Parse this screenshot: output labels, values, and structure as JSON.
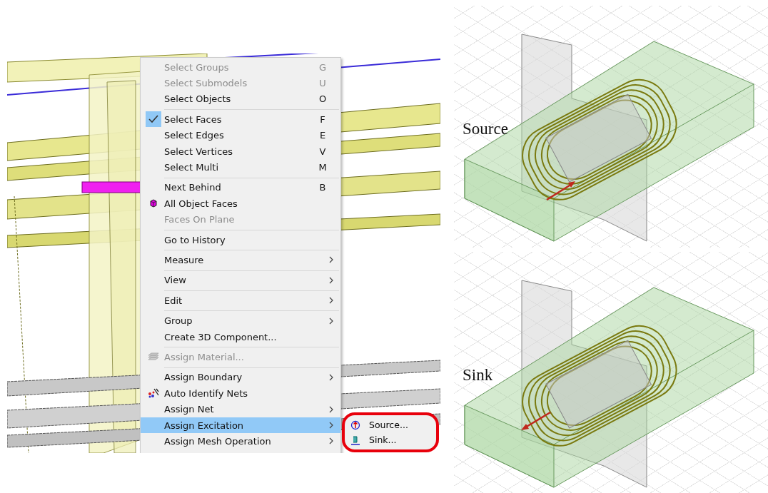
{
  "context_menu": {
    "groups": [
      [
        {
          "label": "Select Groups",
          "shortcut": "G",
          "disabled": true,
          "checked": false,
          "selected": false,
          "kind": "text"
        },
        {
          "label": "Select Submodels",
          "shortcut": "U",
          "disabled": true,
          "checked": false,
          "selected": false,
          "kind": "text"
        },
        {
          "label": "Select Objects",
          "shortcut": "O",
          "disabled": false,
          "checked": false,
          "selected": false,
          "kind": "text"
        }
      ],
      [
        {
          "label": "Select Faces",
          "shortcut": "F",
          "disabled": false,
          "checked": true,
          "selected": false,
          "kind": "text"
        },
        {
          "label": "Select Edges",
          "shortcut": "E",
          "disabled": false,
          "checked": false,
          "selected": false,
          "kind": "text"
        },
        {
          "label": "Select Vertices",
          "shortcut": "V",
          "disabled": false,
          "checked": false,
          "selected": false,
          "kind": "text"
        },
        {
          "label": "Select Multi",
          "shortcut": "M",
          "disabled": false,
          "checked": false,
          "selected": false,
          "kind": "text"
        }
      ],
      [
        {
          "label": "Next Behind",
          "shortcut": "B",
          "disabled": false,
          "checked": false,
          "selected": false,
          "kind": "text"
        },
        {
          "label": "All Object Faces",
          "disabled": false,
          "checked": false,
          "selected": false,
          "kind": "faces"
        },
        {
          "label": "Faces On Plane",
          "disabled": true,
          "checked": false,
          "selected": false,
          "kind": "text"
        }
      ],
      [
        {
          "label": "Go to History",
          "disabled": false,
          "checked": false,
          "selected": false,
          "kind": "text"
        }
      ],
      [
        {
          "label": "Measure",
          "submenu": true,
          "disabled": false,
          "checked": false,
          "selected": false,
          "kind": "text"
        }
      ],
      [
        {
          "label": "View",
          "submenu": true,
          "disabled": false,
          "checked": false,
          "selected": false,
          "kind": "text"
        }
      ],
      [
        {
          "label": "Edit",
          "submenu": true,
          "disabled": false,
          "checked": false,
          "selected": false,
          "kind": "text"
        }
      ],
      [
        {
          "label": "Group",
          "submenu": true,
          "disabled": false,
          "checked": false,
          "selected": false,
          "kind": "text"
        },
        {
          "label": "Create 3D Component...",
          "disabled": false,
          "checked": false,
          "selected": false,
          "kind": "text"
        }
      ],
      [
        {
          "label": "Assign Material...",
          "disabled": true,
          "checked": false,
          "selected": false,
          "kind": "material"
        }
      ],
      [
        {
          "label": "Assign Boundary",
          "submenu": true,
          "disabled": false,
          "checked": false,
          "selected": false,
          "kind": "text"
        },
        {
          "label": "Auto Identify Nets",
          "disabled": false,
          "checked": false,
          "selected": false,
          "kind": "nets"
        },
        {
          "label": "Assign Net",
          "submenu": true,
          "disabled": false,
          "checked": false,
          "selected": false,
          "kind": "text"
        },
        {
          "label": "Assign Excitation",
          "submenu": true,
          "disabled": false,
          "checked": false,
          "selected": true,
          "kind": "text"
        },
        {
          "label": "Assign Mesh Operation",
          "submenu": true,
          "disabled": false,
          "checked": false,
          "selected": false,
          "kind": "text"
        }
      ]
    ]
  },
  "submenu": {
    "highlighted": true,
    "items": [
      {
        "label": "Source...",
        "kind": "source"
      },
      {
        "label": "Sink...",
        "kind": "sink"
      }
    ]
  },
  "views": [
    {
      "label": "Source",
      "kind": "source"
    },
    {
      "label": "Sink",
      "kind": "sink"
    }
  ]
}
